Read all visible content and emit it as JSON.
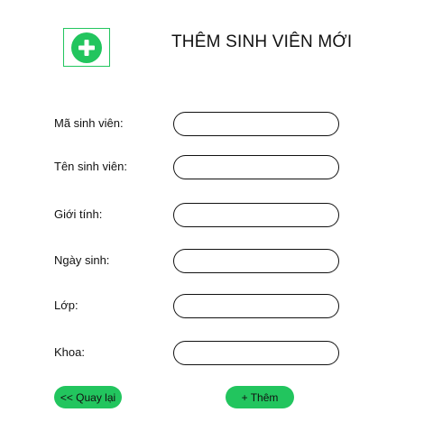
{
  "header": {
    "icon": "plus-circle-icon",
    "title": "THÊM SINH VIÊN MỚI"
  },
  "form": {
    "fields": [
      {
        "label": "Mã sinh viên:",
        "value": "",
        "placeholder": ""
      },
      {
        "label": "Tên sinh viên:",
        "value": "",
        "placeholder": ""
      },
      {
        "label": "Giới tính:",
        "value": "",
        "placeholder": ""
      },
      {
        "label": "Ngày sinh:",
        "value": "",
        "placeholder": ""
      },
      {
        "label": "Lớp:",
        "value": "",
        "placeholder": ""
      },
      {
        "label": "Khoa:",
        "value": "",
        "placeholder": ""
      }
    ]
  },
  "actions": {
    "back_label": "<< Quay lại",
    "add_label": "+ Thêm"
  },
  "colors": {
    "accent": "#22c55e",
    "text": "#111111",
    "border": "#111111",
    "background": "#ffffff"
  }
}
